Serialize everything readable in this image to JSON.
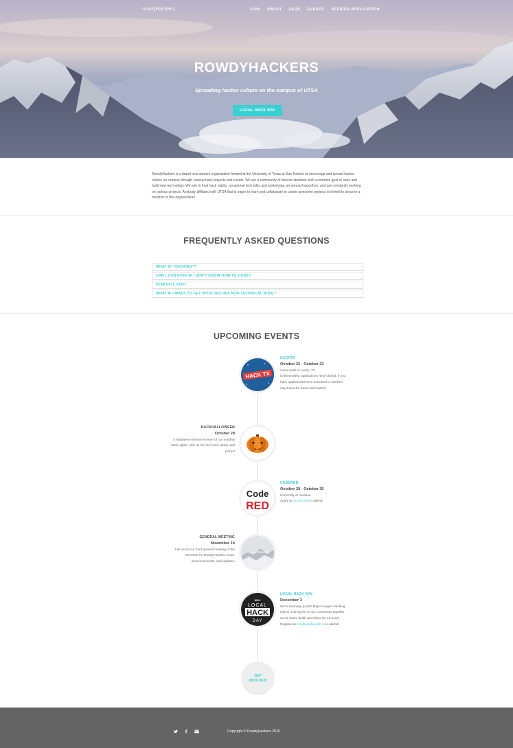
{
  "nav": {
    "brand": "rowdyHackers;",
    "links": [
      "JOIN",
      "ABOUT",
      "FAQS",
      "EVENTS",
      "OFFICER APPLICATION"
    ]
  },
  "hero": {
    "title": "ROWDYHACKERS",
    "subtitle": "Spreading hacker culture on the campus of UTSA",
    "button": "LOCAL HACK DAY"
  },
  "about": {
    "text": "RowdyHackers is a brand new student organization formed at the University of Texas at San Antonio to encourage and spread hacker culture on campus through various hack projects and events. We are a community of diverse students with a common goal to learn and build new technology. We aim to host hack nights, occasional tech talks and workshops, an annual hackathon, and are constantly working on various projects. Anybody affiliated with UTSA that is eager to learn and collaborate to create awesome projects is invited to become a member of this organization!"
  },
  "faq": {
    "title": "FREQUENTLY ASKED QUESTIONS",
    "items": [
      "WHAT IS \"HACKING\"?",
      "CAN I JOIN EVEN IF I DON'T KNOW HOW TO CODE?",
      "HOW DO I JOIN?",
      "WHAT IF I WANT TO GET INVOLVED IN A NON-TECHNICAL ROLE?"
    ]
  },
  "events": {
    "title": "UPCOMING EVENTS",
    "hacktx": {
      "name": "HACKTX",
      "date": "October 22 - October 23",
      "location": "Omni Hotel in Austin, TX",
      "desc": "Unfortunately, applications have closed. If you have applied and been accepted to HackTX, stay tuned for travel information!",
      "logo_text": "HACK TX"
    },
    "hackhalloween": {
      "name": "HACKHALLOWEEN",
      "date": "October 28",
      "desc": "A halloween-themed version of our monthly hack nights. Join us for free food, candy, and prizes!"
    },
    "codered": {
      "name": "CODERED",
      "date": "October 29 - October 30",
      "location": "University of Houston",
      "desc_prefix": "Apply at",
      "link": "uhcode.red",
      "desc_suffix": "to attend!",
      "logo_top": "Code",
      "logo_bottom": "RED"
    },
    "general": {
      "name": "GENERAL MEETING",
      "date": "November 14",
      "desc": "Join us for our third general meeting of the semester for RowdyHackers news, announcements, and updates.",
      "logo_text": "General Meeting"
    },
    "localhackday": {
      "name": "LOCAL HACK DAY",
      "date": "December 3",
      "desc": "We're teaming up with Major League Hacking (MLH) to bring the UTSA community together as we learn, build, and share for 12 hours. Register at",
      "link": "localhackday.mlh.io",
      "desc_suffix": "to attend!",
      "logo_mlh": "MLH",
      "logo_local": "LOCAL",
      "logo_hack": "HACK",
      "logo_day": "DAY"
    },
    "get_involved": [
      "GET",
      "INVOLVED!"
    ]
  },
  "footer": {
    "icons": [
      "twitter-icon",
      "facebook-icon",
      "mail-icon"
    ],
    "copyright": "Copyright © RowdyHackers 2016"
  },
  "colors": {
    "accent": "#38cfd1",
    "footer": "#646464",
    "hacktx_bg": "#1f5f9a",
    "codered_red": "#d8232a"
  }
}
